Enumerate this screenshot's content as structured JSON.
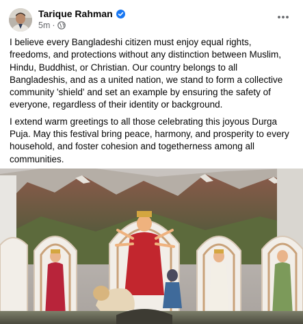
{
  "post": {
    "author": "Tarique Rahman",
    "timestamp": "5m",
    "separator": "·",
    "privacy_icon": "globe-icon",
    "verified_icon": "verified-badge-icon",
    "more_icon": "more-options-icon",
    "paragraphs": [
      "I believe every Bangladeshi citizen must enjoy equal rights, freedoms, and protections without any distinction between Muslim, Hindu, Buddhist, or Christian. Our country belongs to all Bangladeshis, and as a united nation, we stand to form a collective community 'shield' and set an example by ensuring the safety of everyone, regardless of their identity or background.",
      "I extend warm greetings to all those celebrating this joyous Durga Puja. May this festival bring peace, harmony, and prosperity to every household, and foster cohesion and togetherness among all communities."
    ]
  },
  "colors": {
    "verified_blue": "#1877f2",
    "secondary_text": "#65676b",
    "primary_text": "#050505"
  }
}
